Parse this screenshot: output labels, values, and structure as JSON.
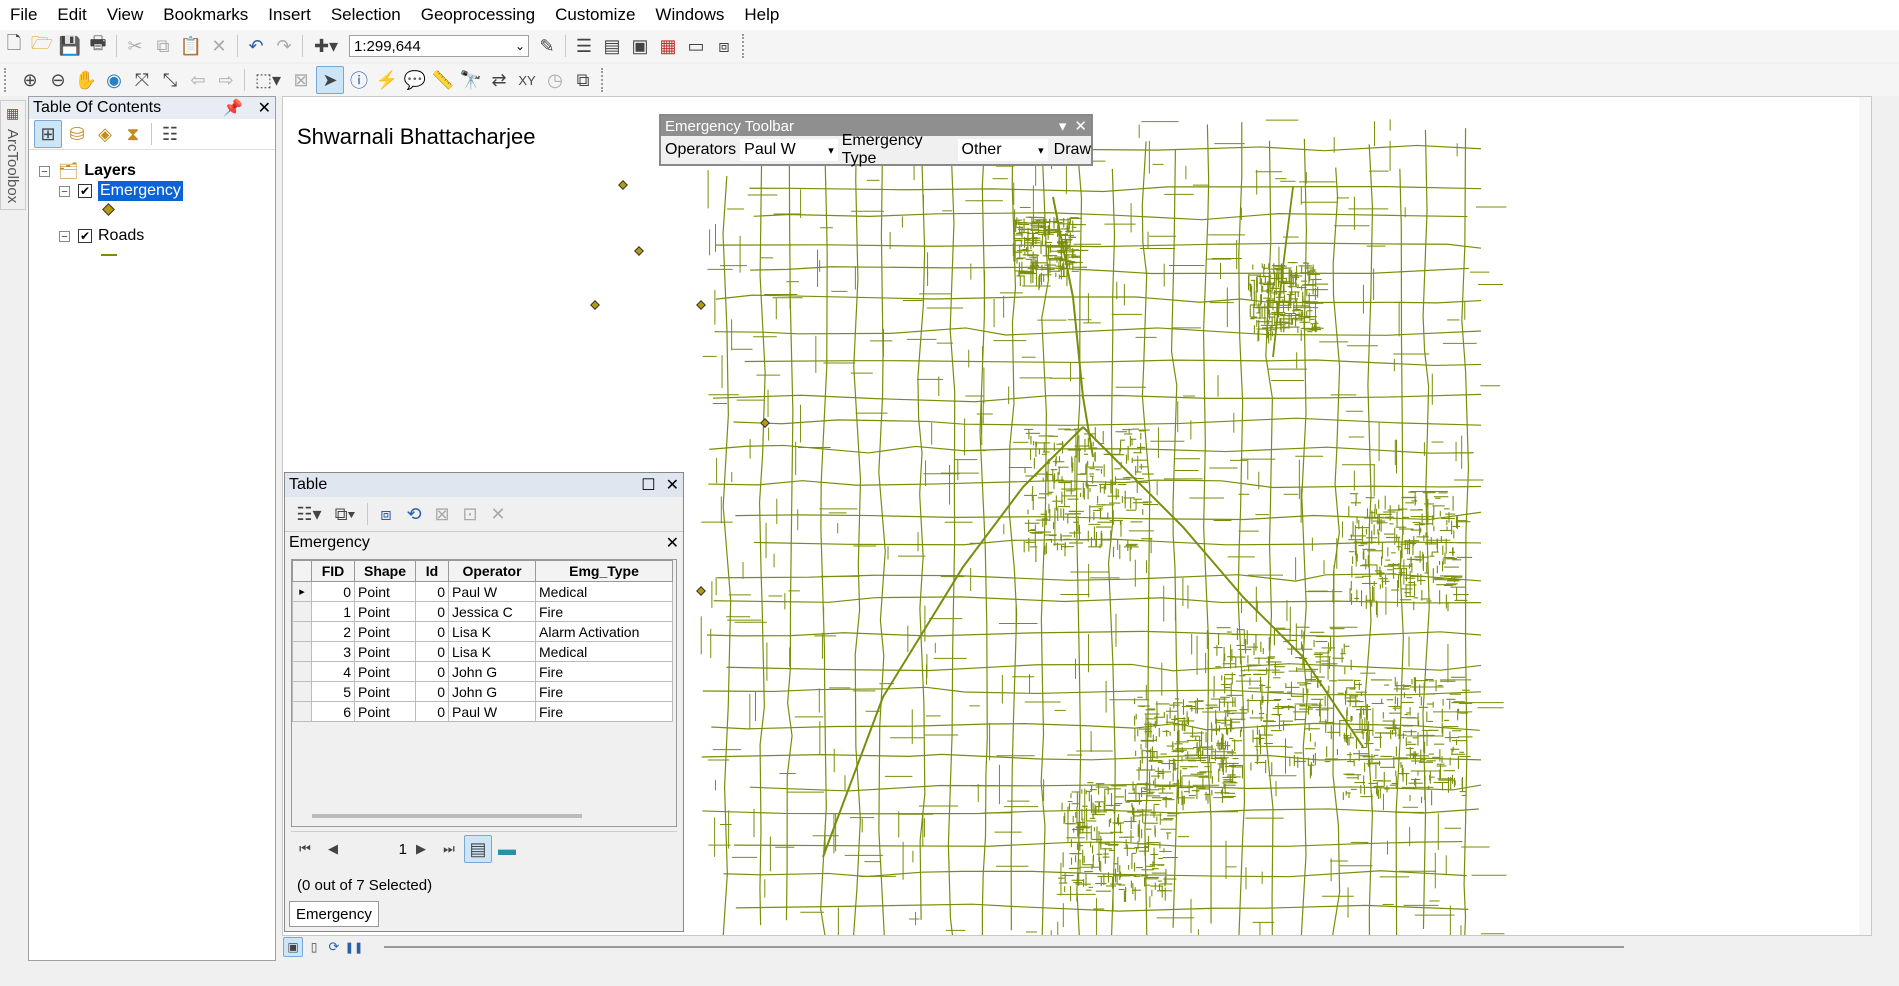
{
  "menu": [
    "File",
    "Edit",
    "View",
    "Bookmarks",
    "Insert",
    "Selection",
    "Geoprocessing",
    "Customize",
    "Windows",
    "Help"
  ],
  "toolbar": {
    "scale": "1:299,644"
  },
  "arctoolbox": {
    "label": "ArcToolbox"
  },
  "toc": {
    "title": "Table Of Contents",
    "layers_label": "Layers",
    "layers": [
      {
        "name": "Emergency",
        "checked": true,
        "selected": true
      },
      {
        "name": "Roads",
        "checked": true,
        "selected": false
      }
    ]
  },
  "map": {
    "author": "Shwarnali Bhattacharjee",
    "road_color": "#7a8e0a",
    "point_color": "#b59a12"
  },
  "emergency_toolbar": {
    "title": "Emergency Toolbar",
    "operators_label": "Operators",
    "operator_value": "Paul W",
    "type_label": "Emergency Type",
    "type_value": "Other",
    "draw_label": "Draw"
  },
  "table": {
    "window_title": "Table",
    "layer_title": "Emergency",
    "columns": [
      "FID",
      "Shape",
      "Id",
      "Operator",
      "Emg_Type"
    ],
    "rows": [
      [
        "0",
        "Point",
        "0",
        "Paul W",
        "Medical"
      ],
      [
        "1",
        "Point",
        "0",
        "Jessica C",
        "Fire"
      ],
      [
        "2",
        "Point",
        "0",
        "Lisa K",
        "Alarm Activation"
      ],
      [
        "3",
        "Point",
        "0",
        "Lisa K",
        "Medical"
      ],
      [
        "4",
        "Point",
        "0",
        "John G",
        "Fire"
      ],
      [
        "5",
        "Point",
        "0",
        "John G",
        "Fire"
      ],
      [
        "6",
        "Point",
        "0",
        "Paul W",
        "Fire"
      ]
    ],
    "page": "1",
    "status": "(0 out of 7 Selected)",
    "tab_label": "Emergency"
  }
}
